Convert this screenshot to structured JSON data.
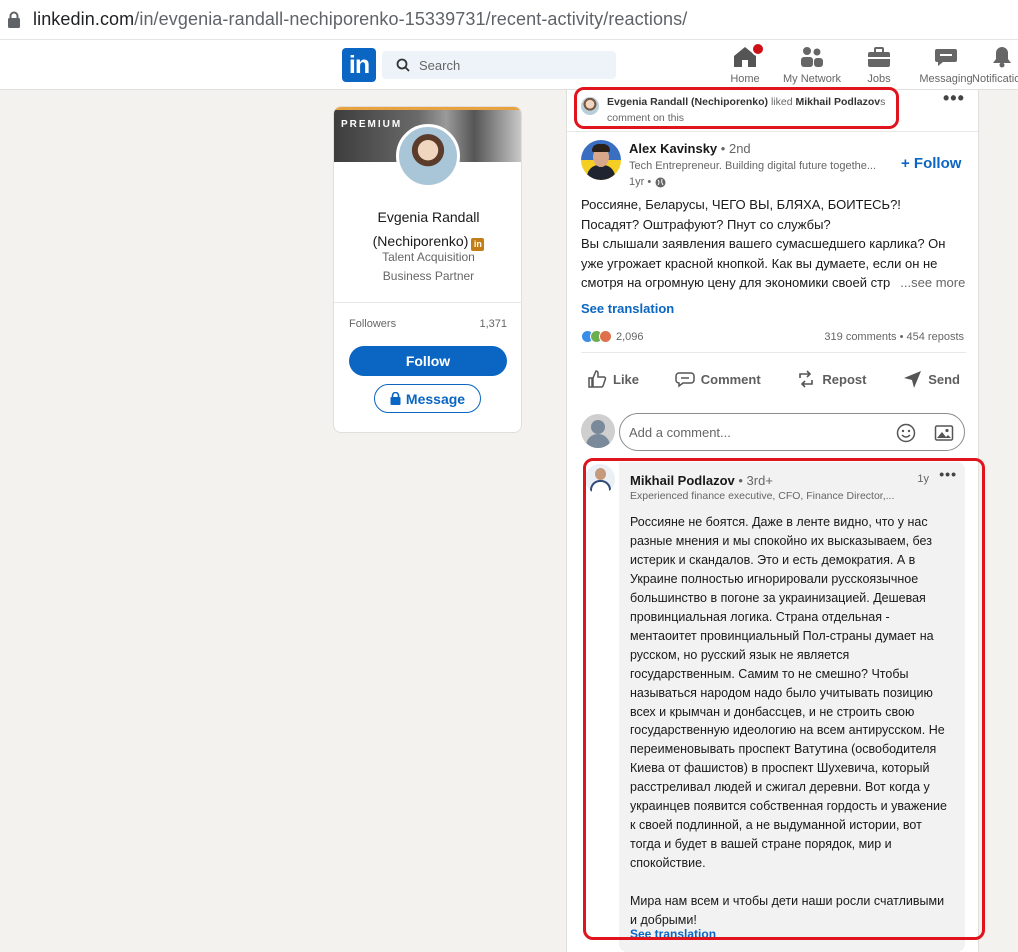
{
  "browser": {
    "url_host": "linkedin.com",
    "url_path": "/in/evgenia-randall-nechiporenko-15339731/recent-activity/reactions/"
  },
  "nav": {
    "search_placeholder": "Search",
    "items": [
      {
        "label": "Home",
        "icon": "home-icon"
      },
      {
        "label": "My Network",
        "icon": "network-icon"
      },
      {
        "label": "Jobs",
        "icon": "briefcase-icon"
      },
      {
        "label": "Messaging",
        "icon": "messaging-icon"
      },
      {
        "label": "Notifications",
        "icon": "bell-icon"
      }
    ]
  },
  "profile": {
    "premium_label": "PREMIUM",
    "name_line1": "Evgenia Randall",
    "name_line2": "(Nechiporenko)",
    "in_badge": "in",
    "title_line1": "Talent Acquisition",
    "title_line2": "Business Partner",
    "followers_label": "Followers",
    "followers_count": "1,371",
    "follow_label": "Follow",
    "message_label": "Message"
  },
  "activity": {
    "actor": "Evgenia Randall (Nechiporenko)",
    "verb": "liked",
    "target": "Mikhail Podlazov",
    "suffix": "s",
    "line2": "comment on this"
  },
  "post": {
    "author_name": "Alex Kavinsky",
    "author_degree": "• 2nd",
    "author_headline": "Tech Entrepreneur. Building digital future togethe...",
    "time": "1yr •",
    "follow_label": "+ Follow",
    "text_lines": [
      "Россияне, Беларусы, ЧЕГО ВЫ, БЛЯХА, БОИТЕСЬ?!",
      "Посадят? Оштрафуют? Пнут со службы?",
      "Вы слышали заявления вашего сумасшедшего карлика? Он",
      "уже угрожает красной кнопкой. Как вы думаете, если он не",
      "смотря на огромную цену для экономики своей стр"
    ],
    "see_more": "...see more",
    "see_translation": "See translation",
    "reactions_count": "2,096",
    "comments_reposts": "319 comments • 454 reposts",
    "actions": {
      "like": "Like",
      "comment": "Comment",
      "repost": "Repost",
      "send": "Send"
    },
    "comment_placeholder": "Add a comment..."
  },
  "comment": {
    "name": "Mikhail Podlazov",
    "degree": "• 3rd+",
    "headline": "Experienced finance executive, CFO, Finance Director,...",
    "time": "1y",
    "paragraph1": "Россияне не боятся. Даже в ленте видно, что у нас разные мнения и мы спокойно их высказываем, без истерик и скандалов. Это и есть демократия. А в Украине полностью игнорировали русскоязычное большинство в погоне за украинизацией. Дешевая провинциальная логика. Страна отдельная - ментаоитет провинциальный Пол-страны думает на русском, но русский язык не является государственным. Самим то не смешно? Чтобы называться народом надо было учитывать позицию всех и крымчан и донбассцев, и не строить свою государственную идеологию на всем антирусском. Не переименовывать проспект Ватутина (освободителя Киева от фашистов) в проспект Шухевича, который расстреливал людей и сжигал деревни. Вот когда у украинцев появится собственная гордость и уважение к своей подлинной, а не выдуманной истории, вот тогда и будет в вашей стране порядок, мир и спокойствие.",
    "paragraph2": "Мира нам всем и чтобы дети наши росли счатливыми и добрыми!",
    "see_translation": "See translation"
  },
  "colors": {
    "linkedin_blue": "#0a66c2",
    "highlight_red": "#e0141c",
    "premium_gold": "#e7a33e"
  }
}
